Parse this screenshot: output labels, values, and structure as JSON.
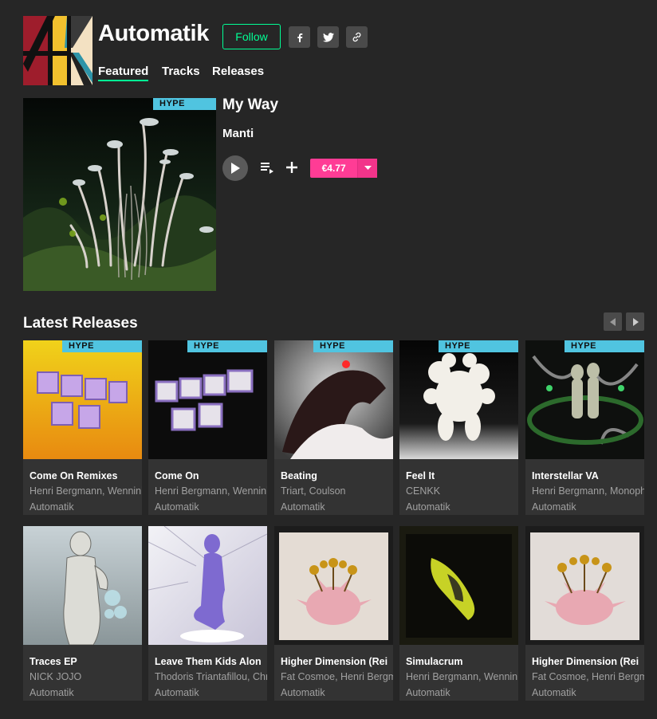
{
  "header": {
    "label_name": "Automatik",
    "follow_label": "Follow",
    "tabs": [
      {
        "label": "Featured",
        "active": true
      },
      {
        "label": "Tracks",
        "active": false
      },
      {
        "label": "Releases",
        "active": false
      }
    ],
    "social": [
      "facebook-icon",
      "twitter-icon",
      "link-icon"
    ]
  },
  "featured": {
    "badge": "HYPE",
    "title": "My Way",
    "artist": "Manti",
    "price": "€4.77"
  },
  "latest": {
    "title": "Latest Releases",
    "releases": [
      {
        "title": "Come On Remixes",
        "artists": "Henri Bergmann, Wenninl",
        "label": "Automatik",
        "hype": true
      },
      {
        "title": "Come On",
        "artists": "Henri Bergmann, Wenninl",
        "label": "Automatik",
        "hype": true
      },
      {
        "title": "Beating",
        "artists": "Triart, Coulson",
        "label": "Automatik",
        "hype": true
      },
      {
        "title": "Feel It",
        "artists": "CENKK",
        "label": "Automatik",
        "hype": true
      },
      {
        "title": "Interstellar VA",
        "artists": "Henri Bergmann, Monoph",
        "label": "Automatik",
        "hype": true
      },
      {
        "title": "Traces EP",
        "artists": "NICK JOJO",
        "label": "Automatik",
        "hype": false
      },
      {
        "title": "Leave Them Kids Alon",
        "artists": "Thodoris Triantafillou, Chr",
        "label": "Automatik",
        "hype": false
      },
      {
        "title": "Higher Dimension (Rei",
        "artists": "Fat Cosmoe, Henri Bergm",
        "label": "Automatik",
        "hype": false
      },
      {
        "title": "Simulacrum",
        "artists": "Henri Bergmann, Wenninl",
        "label": "Automatik",
        "hype": false
      },
      {
        "title": "Higher Dimension (Rei",
        "artists": "Fat Cosmoe, Henri Bergm",
        "label": "Automatik",
        "hype": false
      }
    ]
  },
  "colors": {
    "background": "#262626",
    "accent_green": "#01ff95",
    "hype_blue": "#50c4e0",
    "price_pink": "#ff3c95",
    "card_bg": "#333333"
  }
}
